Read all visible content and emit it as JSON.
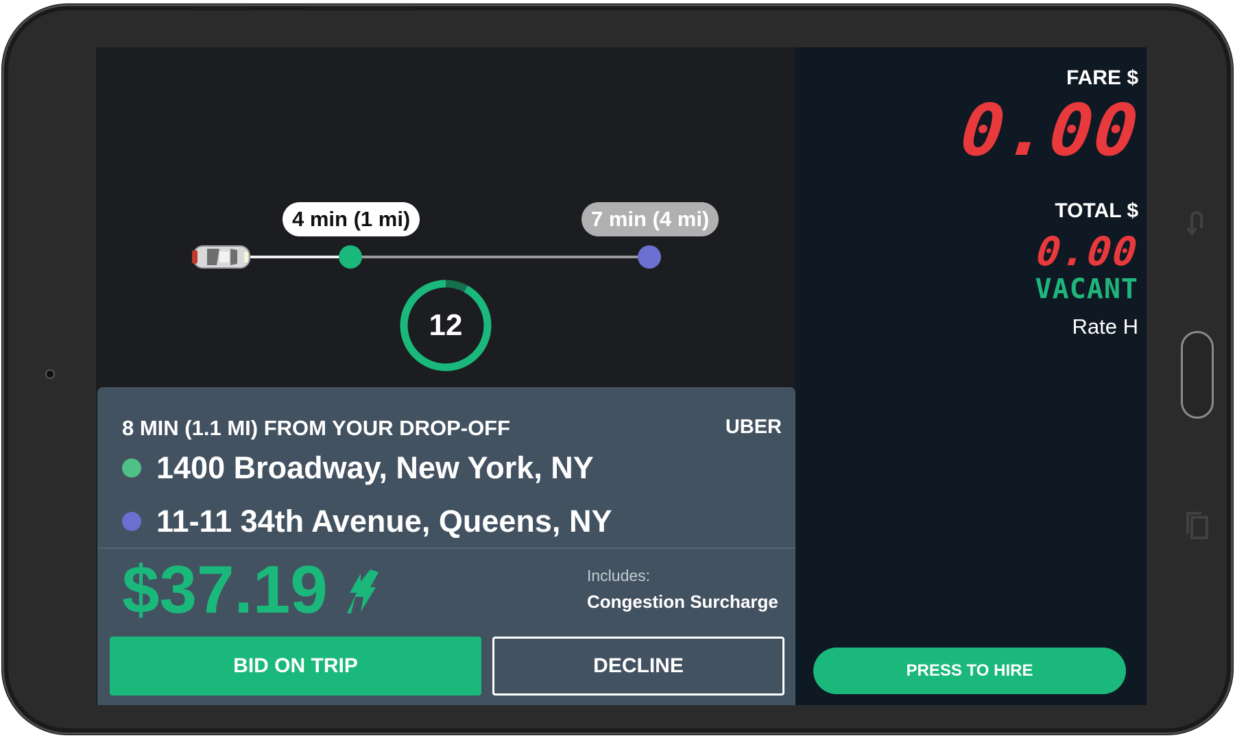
{
  "route": {
    "pickup_eta": "4 min (1 mi)",
    "dropoff_eta": "7 min (4 mi)",
    "countdown": "12",
    "countdown_progress": 0.92
  },
  "trip": {
    "header": "8 MIN (1.1 MI) FROM YOUR DROP-OFF",
    "provider": "UBER",
    "pickup_address": "1400 Broadway, New York, NY",
    "dropoff_address": "11-11 34th Avenue, Queens, NY",
    "price": "$37.19",
    "includes_label": "Includes:",
    "includes_item": "Congestion Surcharge",
    "bid_label": "BID ON TRIP",
    "decline_label": "DECLINE"
  },
  "meter": {
    "fare_label": "FARE $",
    "fare_value": "0.00",
    "total_label": "TOTAL $",
    "total_value": "0.00",
    "status": "VACANT",
    "rate": "Rate H",
    "hire_label": "PRESS TO HIRE"
  },
  "colors": {
    "accent_green": "#1bb87c",
    "dropoff_purple": "#6a6fd0",
    "meter_red": "#e8393d",
    "card_bg": "#435261",
    "meter_bg": "#0f1923"
  },
  "icons": {
    "car": "car-icon",
    "surge": "surge-arrow-icon",
    "back": "back-icon",
    "recent_apps": "recent-apps-icon"
  }
}
